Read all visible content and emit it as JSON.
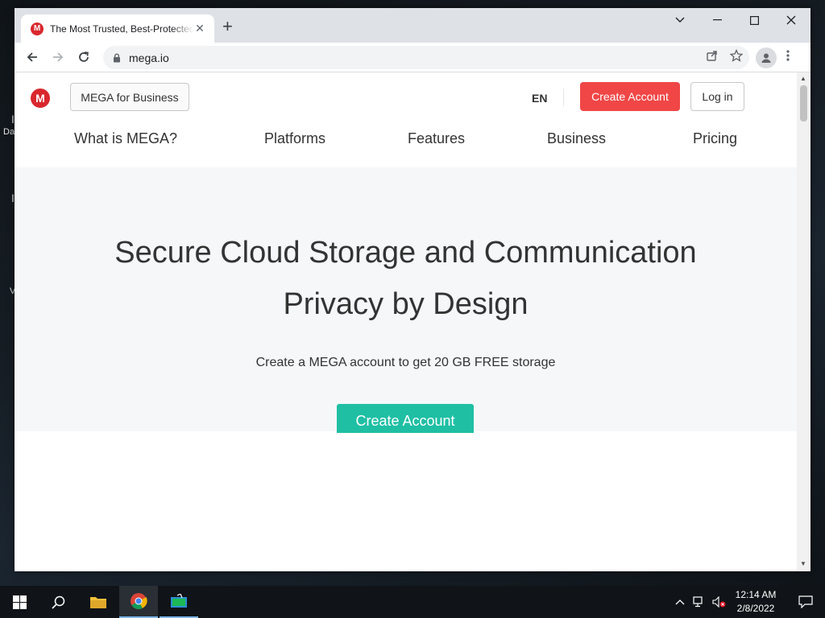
{
  "desktop": {
    "fragments": [
      "I",
      "Da",
      "I",
      "V"
    ]
  },
  "browser": {
    "tab": {
      "title": "The Most Trusted, Best-Protected Cloud Storage",
      "favicon": "M"
    },
    "address": "mega.io"
  },
  "page": {
    "logo": "M",
    "business_button": "MEGA for Business",
    "language": "EN",
    "create_account_top": "Create Account",
    "login": "Log in",
    "nav": [
      "What is MEGA?",
      "Platforms",
      "Features",
      "Business",
      "Pricing"
    ],
    "hero": {
      "title_line1": "Secure Cloud Storage and Communication",
      "title_line2": "Privacy by Design",
      "subtitle": "Create a MEGA account to get 20 GB FREE storage",
      "cta": "Create Account"
    }
  },
  "taskbar": {
    "time": "12:14 AM",
    "date": "2/8/2022"
  },
  "colors": {
    "mega_red": "#d9272e",
    "create_red": "#f04646",
    "cta_teal": "#1fbfa4"
  }
}
